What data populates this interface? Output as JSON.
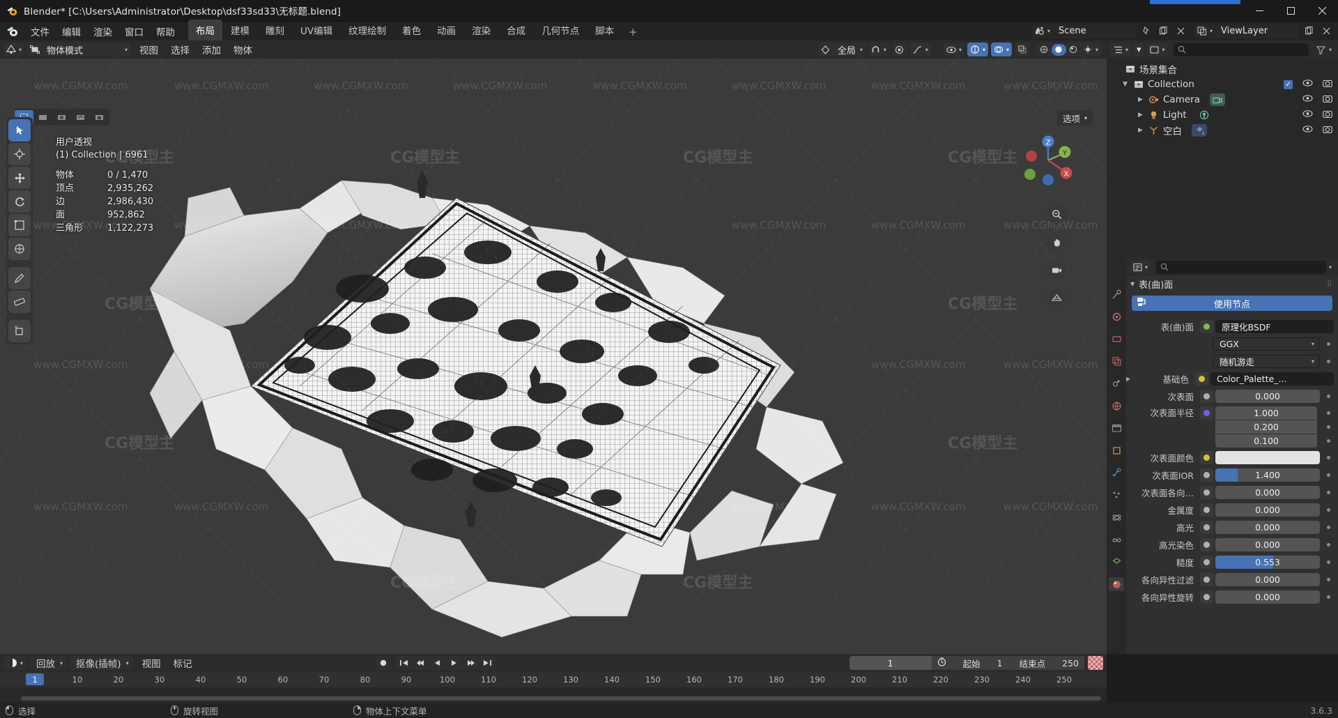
{
  "window": {
    "title": "Blender* [C:\\Users\\Administrator\\Desktop\\dsf33sd33\\无标题.blend]",
    "app_icon": "blender-logo-icon",
    "minimize": "—",
    "maximize": "▭",
    "close": "✕"
  },
  "topbar": {
    "menus": [
      "文件",
      "编辑",
      "渲染",
      "窗口",
      "帮助"
    ],
    "workspaces": [
      {
        "label": "布局",
        "active": true
      },
      {
        "label": "建模",
        "active": false
      },
      {
        "label": "雕刻",
        "active": false
      },
      {
        "label": "UV编辑",
        "active": false
      },
      {
        "label": "纹理绘制",
        "active": false
      },
      {
        "label": "着色",
        "active": false
      },
      {
        "label": "动画",
        "active": false
      },
      {
        "label": "渲染",
        "active": false
      },
      {
        "label": "合成",
        "active": false
      },
      {
        "label": "几何节点",
        "active": false
      },
      {
        "label": "脚本",
        "active": false
      }
    ],
    "add_workspace": "+",
    "scene_name": "Scene",
    "viewlayer_name": "ViewLayer"
  },
  "viewport": {
    "mode": "物体模式",
    "menus": [
      "视图",
      "选择",
      "添加",
      "物体"
    ],
    "transform_orientation": "全局",
    "options_label": "选项",
    "overlay_dropdown": "⌄",
    "stats": {
      "view_name": "用户透视",
      "collection_line": "(1) Collection | 6961",
      "rows": [
        {
          "key": "物体",
          "value": "0 / 1,470"
        },
        {
          "key": "顶点",
          "value": "2,935,262"
        },
        {
          "key": "边",
          "value": "2,986,430"
        },
        {
          "key": "面",
          "value": "952,862"
        },
        {
          "key": "三角形",
          "value": "1,122,273"
        }
      ]
    },
    "gizmo_axes": [
      "Z",
      "Y",
      "X"
    ],
    "nav_buttons": [
      "zoom-icon",
      "hand-icon",
      "camera-icon",
      "grid-icon"
    ],
    "tools": [
      {
        "name": "tweak-tool",
        "glyph": "⬚",
        "active": true
      },
      {
        "name": "cursor-tool",
        "glyph": "✛",
        "active": false
      },
      {
        "name": "move-tool",
        "glyph": "✥",
        "active": false
      },
      {
        "name": "rotate-tool",
        "glyph": "⟳",
        "active": false
      },
      {
        "name": "scale-tool",
        "glyph": "⤡",
        "active": false
      },
      {
        "name": "transform-tool",
        "glyph": "◈",
        "active": false
      },
      {
        "name": "annotate-tool",
        "glyph": "✎",
        "active": false
      },
      {
        "name": "measure-tool",
        "glyph": "📏",
        "active": false
      },
      {
        "name": "add-cube-tool",
        "glyph": "▣",
        "active": false
      }
    ],
    "watermark_text": "www.CGMXW.com",
    "watermark_logo": "CG模型主"
  },
  "outliner": {
    "search_placeholder": "",
    "root": "场景集合",
    "rows": [
      {
        "indent": 0,
        "icon": "collection-icon",
        "name": "Collection",
        "has_tri": true,
        "expanded": true,
        "checkbox": true,
        "eye": true,
        "camera": true,
        "badge": null
      },
      {
        "indent": 1,
        "icon": "camera-data-icon",
        "name": "Camera",
        "has_tri": true,
        "expanded": false,
        "checkbox": false,
        "eye": true,
        "camera": true,
        "badge": "camera-badge"
      },
      {
        "indent": 1,
        "icon": "light-data-icon",
        "name": "Light",
        "has_tri": true,
        "expanded": false,
        "checkbox": false,
        "eye": true,
        "camera": true,
        "badge": "light-badge"
      },
      {
        "indent": 1,
        "icon": "empty-axes-icon",
        "name": "空白",
        "has_tri": true,
        "expanded": false,
        "checkbox": false,
        "eye": true,
        "camera": true,
        "badge": "mesh-badge-1k"
      }
    ]
  },
  "properties": {
    "breadcrumb": "",
    "search_placeholder": "",
    "panel_title": "表(曲)面",
    "use_nodes_label": "使用节点",
    "tabs": [
      "tool-tab",
      "render-tab",
      "output-tab",
      "viewlayer-tab",
      "scene-tab",
      "world-tab",
      "collection-tab",
      "object-tab",
      "modifier-tab",
      "particles-tab",
      "physics-tab",
      "constraint-tab",
      "data-tab",
      "material-tab"
    ],
    "selected_tab": "material-tab",
    "rows": [
      {
        "type": "enum_named",
        "label": "表(曲)面",
        "dot": "#7bbd4e",
        "value": "原理化BSDF",
        "style": "dark"
      },
      {
        "type": "enum",
        "label": "",
        "value": "GGX",
        "style": "enum"
      },
      {
        "type": "enum",
        "label": "",
        "value": "随机游走",
        "style": "enum"
      },
      {
        "type": "named",
        "label": "基础色",
        "dot": "#d6c22e",
        "value": "Color_Palette_...",
        "style": "dark",
        "tri": true
      },
      {
        "type": "value",
        "label": "次表面",
        "dot": "#b0b0b0",
        "value": "0.000",
        "fill": 0
      },
      {
        "type": "stack",
        "label": "次表面半径",
        "dot": "#6f63e8",
        "values": [
          "1.000",
          "0.200",
          "0.100"
        ]
      },
      {
        "type": "color",
        "label": "次表面颜色",
        "dot": "#d6c22e",
        "swatch": "#e6e6e6"
      },
      {
        "type": "value",
        "label": "次表面IOR",
        "dot": "#b0b0b0",
        "value": "1.400",
        "fill": 21
      },
      {
        "type": "value",
        "label": "次表面各向…",
        "dot": "#b0b0b0",
        "value": "0.000",
        "fill": 0
      },
      {
        "type": "value",
        "label": "金属度",
        "dot": "#b0b0b0",
        "value": "0.000",
        "fill": 0
      },
      {
        "type": "value",
        "label": "高光",
        "dot": "#b0b0b0",
        "value": "0.000",
        "fill": 0
      },
      {
        "type": "value",
        "label": "高光染色",
        "dot": "#b0b0b0",
        "value": "0.000",
        "fill": 0
      },
      {
        "type": "value",
        "label": "糙度",
        "dot": "#b0b0b0",
        "value": "0.553",
        "fill": 55
      },
      {
        "type": "value",
        "label": "各向异性过滤",
        "dot": "#b0b0b0",
        "value": "0.000",
        "fill": 0
      },
      {
        "type": "value",
        "label": "各向异性旋转",
        "dot": "#b0b0b0",
        "value": "0.000",
        "fill": 0
      }
    ]
  },
  "timeline": {
    "editor_icon": "timeline-icon",
    "menus": [
      "回放",
      "抠像(插帧)",
      "视图",
      "标记"
    ],
    "dropdowns": [
      "回放",
      "抠像(插帧)"
    ],
    "playback_buttons": [
      "jump-start",
      "prev-keyframe",
      "play-reverse",
      "play",
      "next-keyframe",
      "jump-end"
    ],
    "record_button": "auto-keying-icon",
    "current_frame": "1",
    "start_label": "起始",
    "start_value": "1",
    "end_label": "结束点",
    "end_value": "250",
    "ticks": [
      10,
      20,
      30,
      40,
      50,
      60,
      70,
      80,
      90,
      100,
      110,
      120,
      130,
      140,
      150,
      160,
      170,
      180,
      190,
      200,
      210,
      220,
      230,
      240,
      250
    ],
    "playhead_frame": "1"
  },
  "statusbar": {
    "items": [
      {
        "icon": "mouse-left-icon",
        "label": "选择"
      },
      {
        "icon": "mouse-middle-icon",
        "label": "旋转视图"
      },
      {
        "icon": "mouse-right-icon",
        "label": "物体上下文菜单"
      }
    ],
    "version": "3.6.3"
  },
  "colors": {
    "accent": "#4772b3",
    "viewport_bg": "#3b3b3b",
    "panel_bg": "#303030",
    "header_bg": "#2b2b2b",
    "editor_bg": "#282828"
  }
}
